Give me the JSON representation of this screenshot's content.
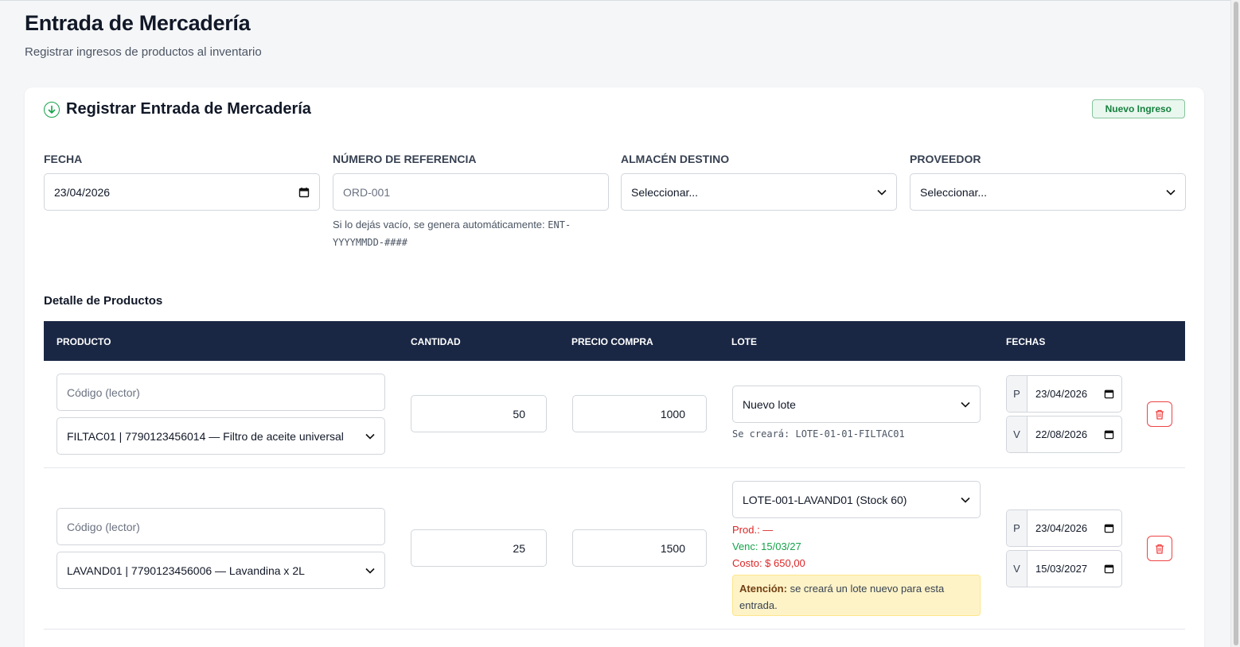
{
  "page": {
    "title": "Entrada de Mercadería",
    "subtitle": "Registrar ingresos de productos al inventario"
  },
  "card": {
    "title": "Registrar Entrada de Mercadería",
    "badge": "Nuevo Ingreso"
  },
  "form": {
    "fecha": {
      "label": "Fecha",
      "value": "23/04/2026"
    },
    "referencia": {
      "label": "Número de Referencia",
      "placeholder": "ORD-001",
      "hint_prefix": "Si lo dejás vacío, se genera automáticamente: ",
      "hint_code_1": "ENT-",
      "hint_code_2": "YYYYMMDD-####"
    },
    "almacen": {
      "label": "Almacén Destino",
      "value": "Seleccionar..."
    },
    "proveedor": {
      "label": "Proveedor",
      "value": "Seleccionar..."
    }
  },
  "detalle": {
    "title": "Detalle de Productos",
    "columns": [
      "PRODUCTO",
      "CANTIDAD",
      "PRECIO COMPRA",
      "LOTE",
      "FECHAS"
    ],
    "rows": [
      {
        "codigo_placeholder": "Código (lector)",
        "producto": "FILTAC01 | 7790123456014 — Filtro de aceite universal",
        "cantidad": "50",
        "precio": "1000",
        "lote": "Nuevo lote",
        "lote_note_label": "Se creará: ",
        "lote_note_code": "LOTE-01-01-FILTAC01",
        "p_label": "P",
        "p_date": "23/04/2026",
        "v_label": "V",
        "v_date": "22/08/2026"
      },
      {
        "codigo_placeholder": "Código (lector)",
        "producto": "LAVAND01 | 7790123456006 — Lavandina x 2L",
        "cantidad": "25",
        "precio": "1500",
        "lote": "LOTE-001-LAVAND01 (Stock 60)",
        "prod_info": "Prod.: —",
        "venc_info": "Venc: 15/03/27",
        "costo_info": "Costo: $ 650,00",
        "warn_bold": "Atención:",
        "warn_text": " se creará un lote nuevo para esta entrada.",
        "p_label": "P",
        "p_date": "23/04/2026",
        "v_label": "V",
        "v_date": "15/03/2027"
      }
    ]
  },
  "colors": {
    "header_bg": "#1a2744",
    "accent_green": "#16a34a",
    "danger_red": "#ef4444",
    "warn_bg": "#fef3c7"
  }
}
